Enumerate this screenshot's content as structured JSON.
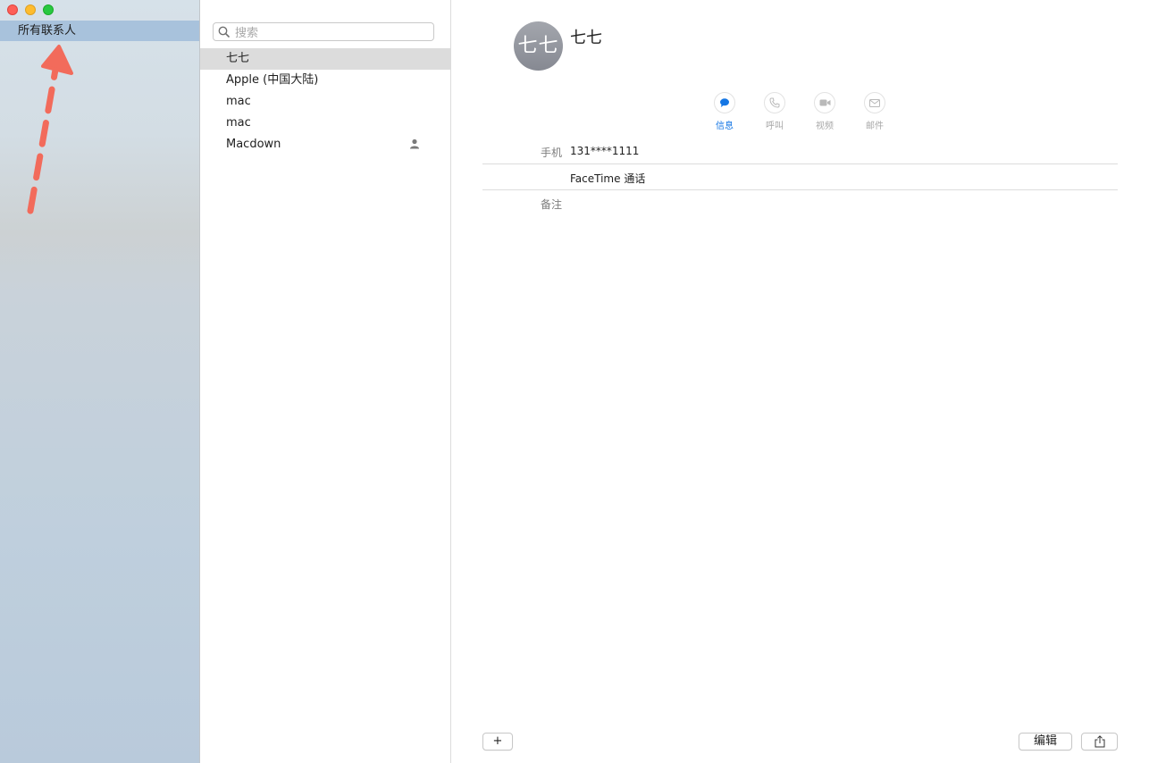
{
  "sidebar": {
    "items": [
      {
        "label": "所有联系人"
      }
    ]
  },
  "list": {
    "search_placeholder": "搜索",
    "contacts": [
      {
        "name": "七七"
      },
      {
        "name": "Apple (中国大陆)"
      },
      {
        "name": "mac"
      },
      {
        "name": "mac"
      },
      {
        "name": "Macdown"
      }
    ]
  },
  "detail": {
    "avatar_initials": "七七",
    "name": "七七",
    "actions": [
      {
        "label": "信息",
        "icon": "message-icon"
      },
      {
        "label": "呼叫",
        "icon": "phone-icon"
      },
      {
        "label": "视频",
        "icon": "video-icon"
      },
      {
        "label": "邮件",
        "icon": "mail-icon"
      }
    ],
    "fields": {
      "mobile_label": "手机",
      "mobile_value": "131****1111",
      "facetime_value": "FaceTime 通话",
      "notes_label": "备注"
    }
  },
  "footer": {
    "add_label": "+",
    "edit_label": "编辑"
  },
  "colors": {
    "accent": "#1476e4",
    "sidebar_selection": "#a8c2dc",
    "annotation_arrow": "#f26b5b"
  }
}
